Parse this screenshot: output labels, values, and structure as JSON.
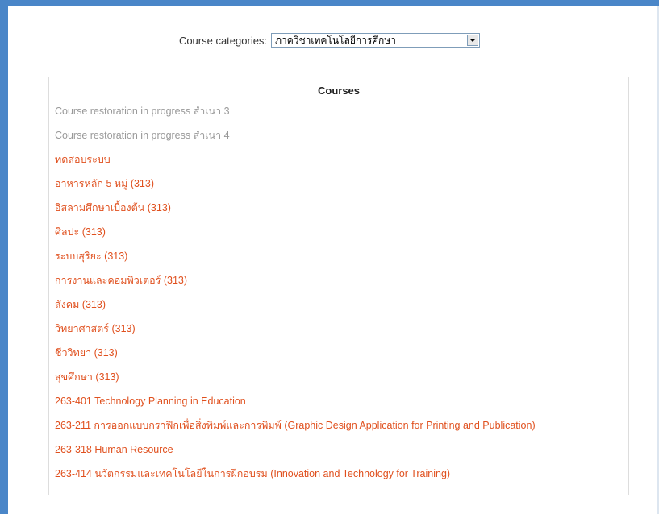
{
  "colors": {
    "accent_bar": "#4a86c8",
    "link": "#e0501e",
    "disabled_link": "#999999"
  },
  "category_selector": {
    "label": "Course categories:",
    "selected": "ภาควิชาเทคโนโลยีการศึกษา"
  },
  "courses": {
    "header": "Courses",
    "items": [
      {
        "label": "Course restoration in progress สำเนา 3",
        "state": "disabled"
      },
      {
        "label": "Course restoration in progress สำเนา 4",
        "state": "disabled"
      },
      {
        "label": "ทดสอบระบบ",
        "state": "active"
      },
      {
        "label": "อาหารหลัก 5 หมู่ (313)",
        "state": "active"
      },
      {
        "label": "อิสลามศึกษาเบื้องต้น (313)",
        "state": "active"
      },
      {
        "label": "ศิลปะ (313)",
        "state": "active"
      },
      {
        "label": "ระบบสุริยะ (313)",
        "state": "active"
      },
      {
        "label": "การงานและคอมพิวเตอร์ (313)",
        "state": "active"
      },
      {
        "label": "สังคม (313)",
        "state": "active"
      },
      {
        "label": "วิทยาศาสตร์ (313)",
        "state": "active"
      },
      {
        "label": "ชีววิทยา (313)",
        "state": "active"
      },
      {
        "label": "สุขศึกษา (313)",
        "state": "active"
      },
      {
        "label": "263-401 Technology Planning in Education",
        "state": "active"
      },
      {
        "label": "263-211 การออกแบบกราฟิกเพื่อสิ่งพิมพ์และการพิมพ์ (Graphic Design Application for Printing and Publication)",
        "state": "active"
      },
      {
        "label": "263-318 Human Resource",
        "state": "active"
      },
      {
        "label": "263-414 นวัตกรรมและเทคโนโลยีในการฝึกอบรม (Innovation and Technology for Training)",
        "state": "active"
      }
    ]
  }
}
